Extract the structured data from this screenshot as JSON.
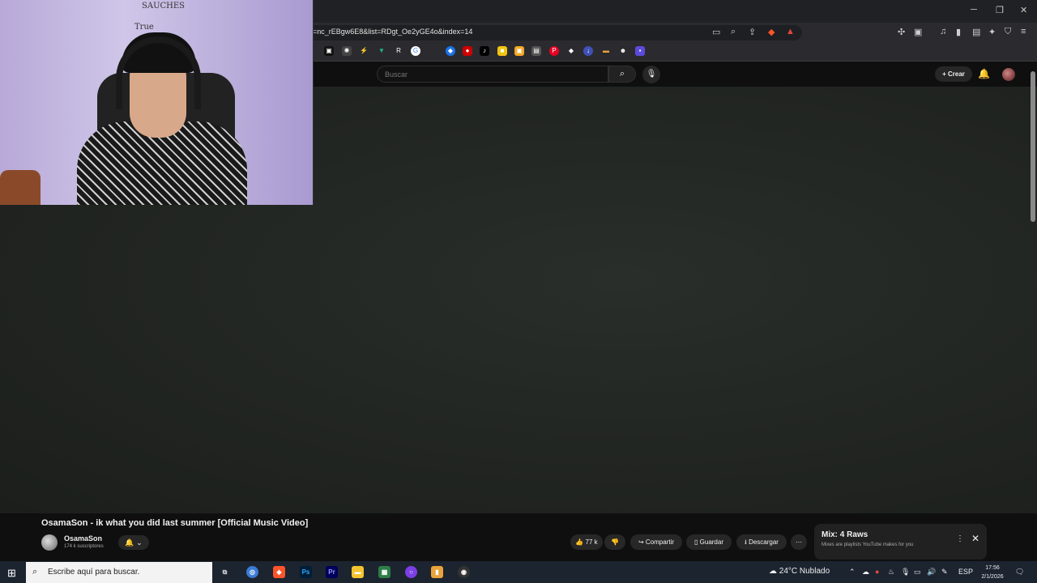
{
  "browser": {
    "url": "=nc_rEBgw6E8&list=RDgt_Oe2yGE4o&index=14",
    "window_controls": {
      "minimize": "─",
      "restore": "❐",
      "close": "✕"
    }
  },
  "youtube": {
    "search_placeholder": "Buscar",
    "create_label": "Crear",
    "video": {
      "title": "OsamaSon - ik what you did last summer [Official Music Video]",
      "channel": "OsamaSon",
      "subscribers": "174 k suscriptores",
      "likes": "77 k",
      "share_label": "Compartir",
      "save_label": "Guardar",
      "download_label": "Descargar"
    },
    "mix": {
      "title": "Mix: 4 Raws",
      "subtitle": "Mixes are playlists YouTube makes for you"
    }
  },
  "taskbar": {
    "search_text": "Escribe aquí para buscar.",
    "weather": "24°C  Nublado",
    "language": "ESP",
    "time": "17:56",
    "date": "2/1/2026"
  },
  "webcam_doodles": {
    "doodle_1": "SAUCHES",
    "doodle_2": "True"
  },
  "colors": {
    "accent_red": "#ff0000",
    "brave_orange": "#fb542b"
  }
}
